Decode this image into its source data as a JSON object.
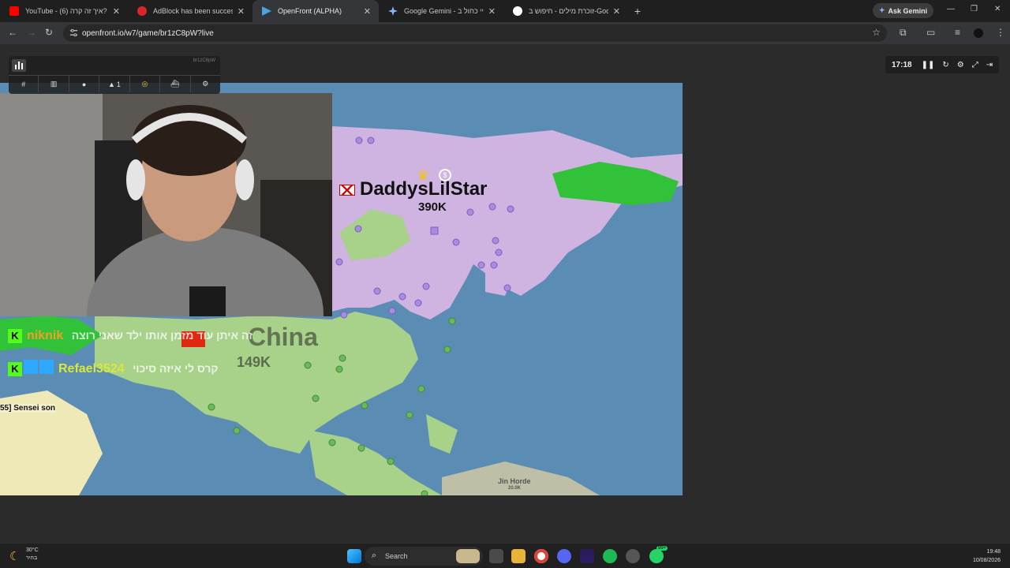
{
  "browser": {
    "tabs": [
      {
        "title": "YouTube - (6) איך זה קרה?",
        "favicon_color": "#ff0000",
        "active": false
      },
      {
        "title": "AdBlock has been successfully",
        "favicon_color": "#d9262a",
        "active": false
      },
      {
        "title": "OpenFront (ALPHA)",
        "favicon_color": "#4aa3df",
        "active": true
      },
      {
        "title": "Google Gemini - השגת יי כחול ב",
        "favicon_color": "#8ab4f8",
        "active": false
      },
      {
        "title": "זוכרת מילים - חיפוש ב-Google",
        "favicon_color": "#ffffff",
        "active": false
      }
    ],
    "ask_gemini": "Ask Gemini",
    "url": "openfront.io/w7/game/br1zC8pW?live"
  },
  "game": {
    "game_id": "br1zC8pW",
    "hud_counts": {
      "troops_icon_count": "1"
    },
    "timer": "17:18",
    "players": [
      {
        "name": "DaddysLilStar",
        "troops": "390K"
      },
      {
        "name": "China",
        "troops": "149K"
      },
      {
        "name": "Jin Horde",
        "troops": "20.0K"
      }
    ],
    "chat": [
      {
        "user": "niknik",
        "message": "זה איתן עוד מזמן אותו ילד שאני רוצה"
      },
      {
        "user": "Refael3524",
        "message": "קרס לי איזה סיכוי"
      }
    ],
    "partial_label": "55] Sensei son",
    "colors": {
      "ocean": "#5b8db4",
      "player_purple": "#cfb3e0",
      "china_green": "#a8d18a",
      "land_green": "#31c23a",
      "chat_orange": "#f0a020",
      "chat_yellow": "#d8e83a"
    }
  },
  "taskbar": {
    "weather_temp": "30°C",
    "weather_desc": "בהיר",
    "search_placeholder": "Search",
    "time": "19:48",
    "date": "10/08/2026",
    "badge": "99+"
  }
}
